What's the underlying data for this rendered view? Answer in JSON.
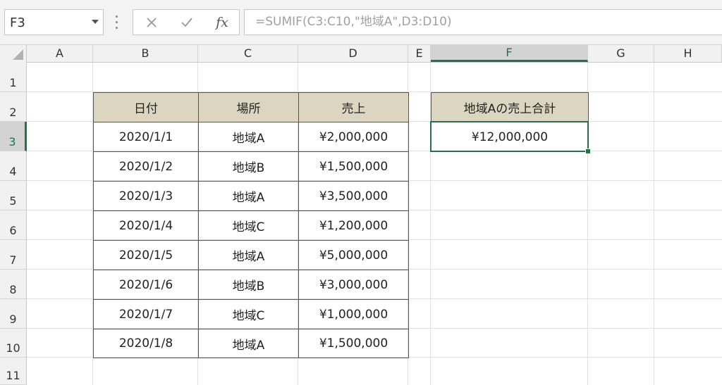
{
  "formula_bar": {
    "name_box": "F3",
    "cancel_icon": "cancel-x-icon",
    "enter_icon": "enter-check-icon",
    "function_label": "fx",
    "formula": "=SUMIF(C3:C10,\"地域A\",D3:D10)"
  },
  "columns": [
    "A",
    "B",
    "C",
    "D",
    "E",
    "F",
    "G",
    "H"
  ],
  "selected_column": "F",
  "rows": [
    "1",
    "2",
    "3",
    "4",
    "5",
    "6",
    "7",
    "8",
    "9",
    "10",
    "11"
  ],
  "selected_row": "3",
  "table": {
    "headers": [
      "日付",
      "場所",
      "売上"
    ],
    "rows": [
      [
        "2020/1/1",
        "地域A",
        "¥2,000,000"
      ],
      [
        "2020/1/2",
        "地域B",
        "¥1,500,000"
      ],
      [
        "2020/1/3",
        "地域A",
        "¥3,500,000"
      ],
      [
        "2020/1/4",
        "地域C",
        "¥1,200,000"
      ],
      [
        "2020/1/5",
        "地域A",
        "¥5,000,000"
      ],
      [
        "2020/1/6",
        "地域B",
        "¥3,000,000"
      ],
      [
        "2020/1/7",
        "地域C",
        "¥1,000,000"
      ],
      [
        "2020/1/8",
        "地域A",
        "¥1,500,000"
      ]
    ]
  },
  "summary": {
    "header": "地域Aの売上合計",
    "value": "¥12,000,000"
  },
  "colors": {
    "accent": "#217346",
    "table_header_fill": "#dcd6c0"
  }
}
